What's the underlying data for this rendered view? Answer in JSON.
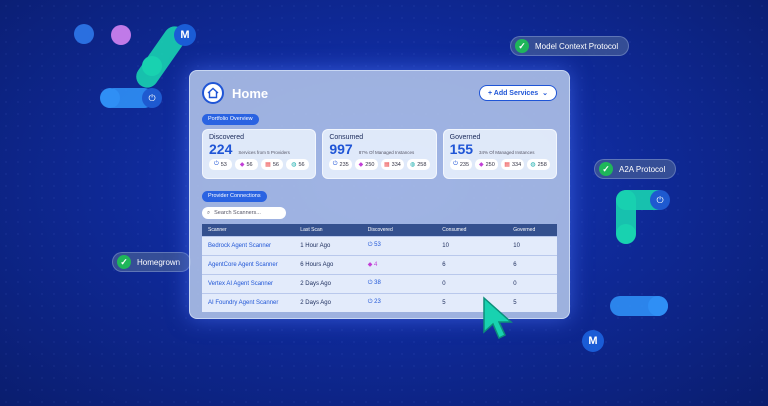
{
  "window": {
    "title": "Home",
    "add_button": "+ Add Services",
    "chevron": "chevron-down-icon"
  },
  "portfolio": {
    "label": "Portfolio Overview",
    "cards": [
      {
        "title": "Discovered",
        "value": "224",
        "sub": "Services from 5 Providers",
        "chips": [
          "53",
          "56",
          "56",
          "56"
        ]
      },
      {
        "title": "Consumed",
        "value": "997",
        "sub": "87% Of Managed Instances",
        "chips": [
          "235",
          "250",
          "334",
          "258"
        ]
      },
      {
        "title": "Governed",
        "value": "155",
        "sub": "34% Of Managed Instances",
        "chips": [
          "235",
          "250",
          "334",
          "258"
        ]
      }
    ]
  },
  "connections": {
    "label": "Provider Connections",
    "search_placeholder": "Search Scanners...",
    "headers": [
      "Scanner",
      "Last Scan",
      "Discovered",
      "Consumed",
      "Governed"
    ],
    "rows": [
      {
        "scanner": "Bedrock Agent Scanner",
        "last": "1 Hour Ago",
        "discovered": "53",
        "consumed": "10",
        "governed": "10"
      },
      {
        "scanner": "AgentCore Agent Scanner",
        "last": "6 Hours Ago",
        "discovered": "4",
        "consumed": "6",
        "governed": "6"
      },
      {
        "scanner": "Vertex AI Agent Scanner",
        "last": "2 Days Ago",
        "discovered": "38",
        "consumed": "0",
        "governed": "0"
      },
      {
        "scanner": "AI Foundry Agent Scanner",
        "last": "2 Days Ago",
        "discovered": "23",
        "consumed": "5",
        "governed": "5"
      }
    ]
  },
  "badges": {
    "mcp": "Model Context Protocol",
    "a2a": "A2A Protocol",
    "homegrown": "Homegrown"
  },
  "colors": {
    "accent": "#1f55d6",
    "teal": "#18d2b0",
    "check": "#1fb65a"
  }
}
